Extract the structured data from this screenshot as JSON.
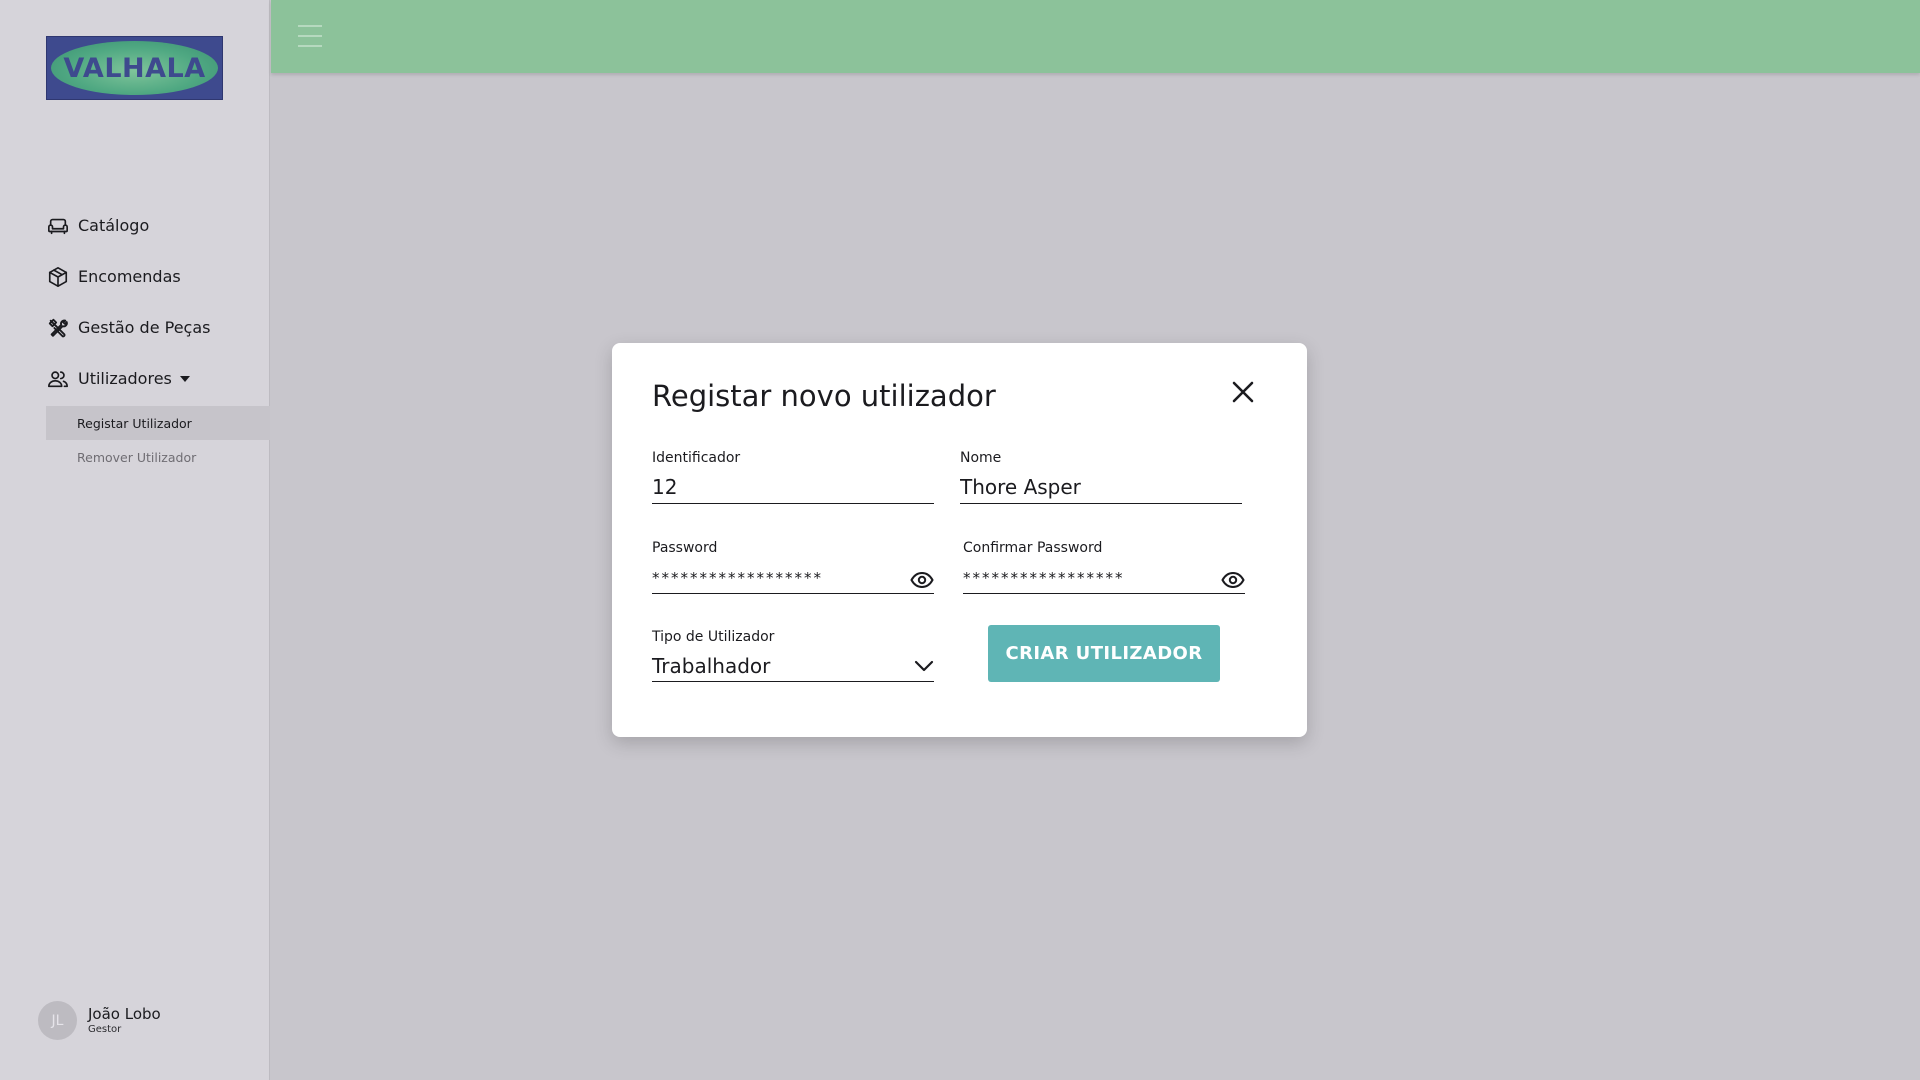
{
  "logo": {
    "text": "VALHALA"
  },
  "sidebar": {
    "items": [
      {
        "label": "Catálogo",
        "icon": "sofa-icon"
      },
      {
        "label": "Encomendas",
        "icon": "package-icon"
      },
      {
        "label": "Gestão de Peças",
        "icon": "tools-icon"
      },
      {
        "label": "Utilizadores",
        "icon": "users-icon",
        "expanded": true
      }
    ],
    "subitems": [
      {
        "label": "Registar Utilizador",
        "active": true
      },
      {
        "label": "Remover Utilizador",
        "active": false
      }
    ]
  },
  "user": {
    "initials": "JL",
    "name": "João Lobo",
    "role": "Gestor"
  },
  "modal": {
    "title": "Registar novo utilizador",
    "fields": {
      "identificador": {
        "label": "Identificador",
        "value": "12"
      },
      "nome": {
        "label": "Nome",
        "value": "Thore Asper"
      },
      "password": {
        "label": "Password",
        "value": "******************"
      },
      "confirm_password": {
        "label": "Confirmar Password",
        "value": "*****************"
      },
      "tipo": {
        "label": "Tipo de Utilizador",
        "value": "Trabalhador"
      }
    },
    "submit_label": "CRIAR UTILIZADOR"
  },
  "colors": {
    "topbar": "#8cc29a",
    "sidebar": "#d6d4da",
    "backdrop": "#c8c6cc",
    "button": "#5fb5b5",
    "logo_bg": "#3e4a8e"
  }
}
